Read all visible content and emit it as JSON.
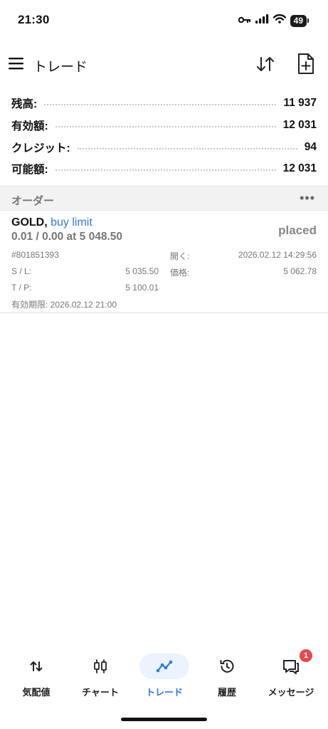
{
  "status_bar": {
    "time": "21:30",
    "battery": "49",
    "icons": [
      "key-icon",
      "signal-icon",
      "wifi-icon",
      "battery-icon"
    ]
  },
  "header": {
    "title": "トレード",
    "icons": [
      "menu-icon",
      "sort-icon",
      "new-order-icon"
    ]
  },
  "summary": [
    {
      "label": "残高:",
      "value": "11 937"
    },
    {
      "label": "有効額:",
      "value": "12 031"
    },
    {
      "label": "クレジット:",
      "value": "94"
    },
    {
      "label": "可能額:",
      "value": "12 031"
    }
  ],
  "orders_section": {
    "title": "オーダー",
    "more": "•••"
  },
  "order": {
    "symbol": "GOLD,",
    "type": "buy limit",
    "volume_price": "0.01 / 0.00 at 5 048.50",
    "status": "placed",
    "ticket": "#801851393",
    "sl_label": "S / L:",
    "sl_value": "5 035.50",
    "tp_label": "T / P:",
    "tp_value": "5 100.01",
    "open_label": "開く:",
    "open_value": "2026.02.12 14:29:56",
    "price_label": "価格:",
    "price_value": "5 062.78",
    "expiry": "有効期限: 2026.02.12 21:00"
  },
  "bottom_nav": {
    "items": [
      {
        "label": "気配値",
        "icon": "quotes-icon"
      },
      {
        "label": "チャート",
        "icon": "chart-icon"
      },
      {
        "label": "トレード",
        "icon": "trade-icon",
        "active": true
      },
      {
        "label": "履歴",
        "icon": "history-icon"
      },
      {
        "label": "メッセージ",
        "icon": "messages-icon",
        "badge": "1"
      }
    ]
  },
  "colors": {
    "accent": "#2f7be0",
    "badge": "#e5484d",
    "muted": "#777777"
  }
}
